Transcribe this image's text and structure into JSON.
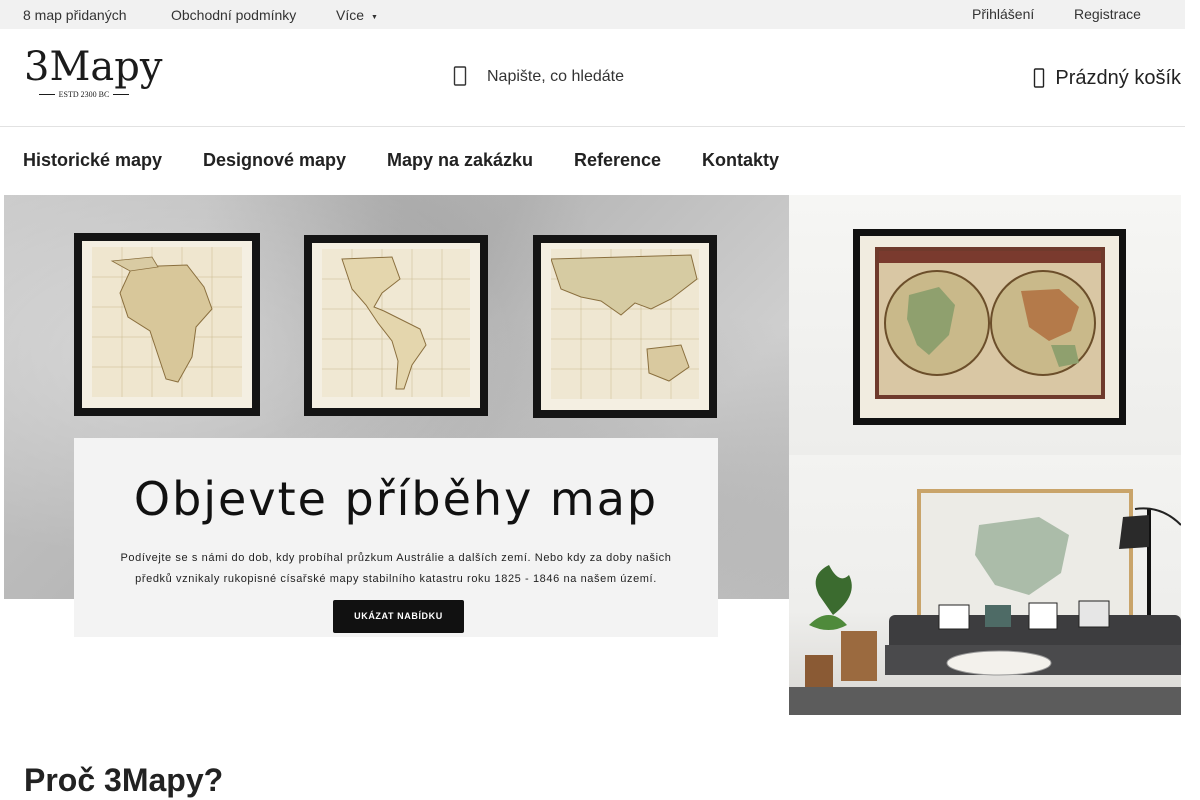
{
  "topbar": {
    "items": [
      "8 map přidaných",
      "Obchodní podmínky",
      "Více"
    ],
    "login": "Přihlášení",
    "register": "Registrace"
  },
  "header": {
    "logo_text": "3Mapy",
    "logo_tagline": "ESTD 2300 BC",
    "search_placeholder": "Napište, co hledáte",
    "cart_label": "Prázdný košík"
  },
  "nav": {
    "items": [
      "Historické mapy",
      "Designové mapy",
      "Mapy na zakázku",
      "Reference",
      "Kontakty"
    ]
  },
  "hero": {
    "title": "Objevte příběhy map",
    "subtitle_line1": "Podívejte se s námi do dob, kdy probíhal průzkum Austrálie a dalších zemí. Nebo kdy za doby  našich",
    "subtitle_line2": "předků vznikaly rukopisné císařské mapy stabilního katastru roku 1825 - 1846 na našem území.",
    "button_label": "UKÁZAT NABÍDKU"
  },
  "section": {
    "title": "Proč 3Mapy?"
  },
  "icons": {
    "search": "search-icon",
    "cart": "cart-icon",
    "more_caret": "caret-down-icon"
  },
  "colors": {
    "topbar_bg": "#f1f1f1",
    "text": "#222222",
    "button_bg": "#111111"
  }
}
